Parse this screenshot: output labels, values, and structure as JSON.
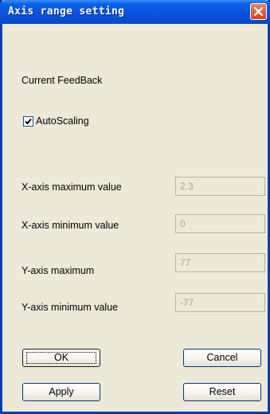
{
  "window": {
    "title": "Axis range setting"
  },
  "section": {
    "current_label": "Current FeedBack"
  },
  "autoscaling": {
    "label": "AutoScaling",
    "checked": true
  },
  "fields": [
    {
      "label": "X-axis maximum value",
      "value": "2.3"
    },
    {
      "label": "X-axis minimum value",
      "value": "0"
    },
    {
      "label": "Y-axis maximum",
      "value": "77"
    },
    {
      "label": "Y-axis minimum value",
      "value": "-77"
    }
  ],
  "buttons": {
    "ok": "OK",
    "cancel": "Cancel",
    "apply": "Apply",
    "reset": "Reset"
  },
  "colors": {
    "titlebar": "#0a53dc",
    "dialog_bg": "#ece9d8",
    "close_button": "#d0451f",
    "disabled_text": "#a7a698"
  },
  "icons": {
    "close": "close-icon",
    "check": "checkmark-icon"
  }
}
